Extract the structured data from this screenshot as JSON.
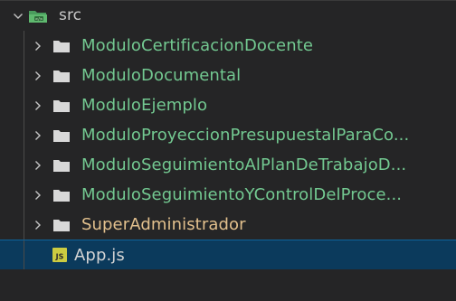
{
  "explorer": {
    "root": {
      "label": "src",
      "icon": "src-folder-open-icon",
      "expanded": true
    },
    "folders": [
      {
        "label": "ModuloCertificacionDocente",
        "status_color": "#73c991"
      },
      {
        "label": "ModuloDocumental",
        "status_color": "#73c991"
      },
      {
        "label": "ModuloEjemplo",
        "status_color": "#73c991"
      },
      {
        "label": "ModuloProyeccionPresupuestalParaCo...",
        "status_color": "#73c991"
      },
      {
        "label": "ModuloSeguimientoAlPlanDeTrabajoD...",
        "status_color": "#73c991"
      },
      {
        "label": "ModuloSeguimientoYControlDelProce...",
        "status_color": "#73c991"
      },
      {
        "label": "SuperAdministrador",
        "status_color": "#e2c08d"
      }
    ],
    "file": {
      "label": "App.js",
      "icon_text": "JS",
      "selected": true
    }
  },
  "colors": {
    "background": "#252526",
    "selection": "#0b3a5c",
    "untracked_green": "#73c991",
    "modified_yellow": "#e2c08d",
    "js_icon_bg": "#cbcb41"
  }
}
